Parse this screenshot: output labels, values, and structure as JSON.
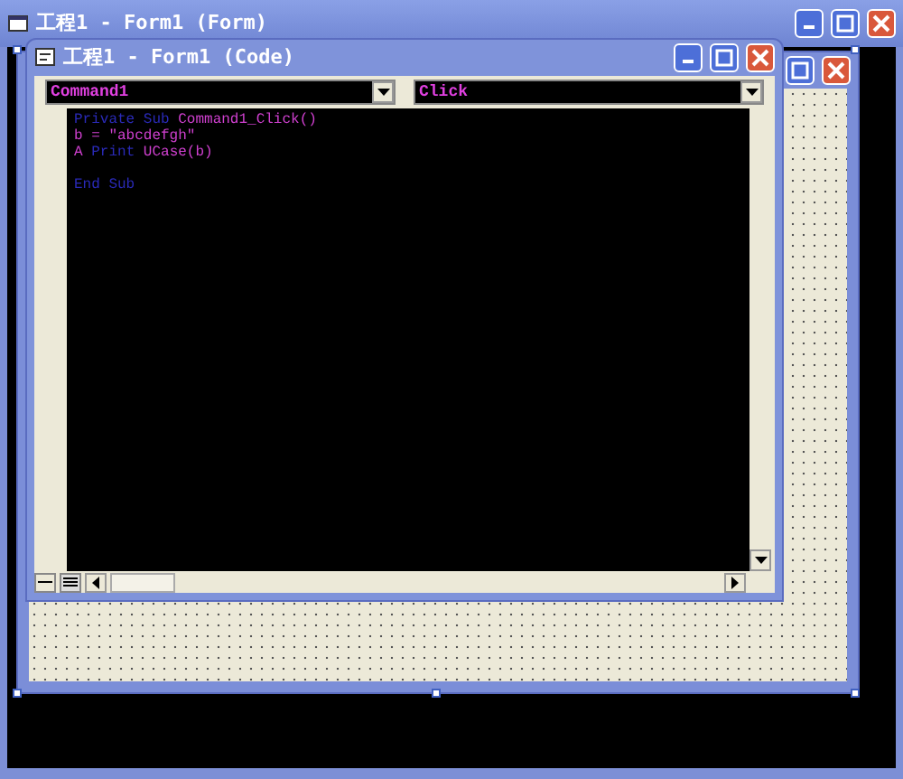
{
  "window": {
    "title": "工程1 - Form1 (Form)"
  },
  "code_window": {
    "title": "工程1 - Form1 (Code)",
    "object_combo": {
      "value": "Command1"
    },
    "procedure_combo": {
      "value": "Click"
    },
    "code_lines": [
      {
        "gap_before": false,
        "tokens": [
          {
            "kind": "keyword",
            "text": "Private Sub"
          },
          {
            "kind": "plain",
            "text": "Command1_Click()"
          }
        ]
      },
      {
        "gap_before": false,
        "tokens": [
          {
            "kind": "plain",
            "text": "b = \"abcdefgh\""
          }
        ]
      },
      {
        "gap_before": false,
        "tokens": [
          {
            "kind": "plain",
            "text": "A"
          },
          {
            "kind": "keyword",
            "text": "Print"
          },
          {
            "kind": "plain",
            "text": "UCase(b)"
          }
        ]
      },
      {
        "gap_before": true,
        "tokens": [
          {
            "kind": "keyword",
            "text": "End Sub"
          }
        ]
      }
    ]
  }
}
